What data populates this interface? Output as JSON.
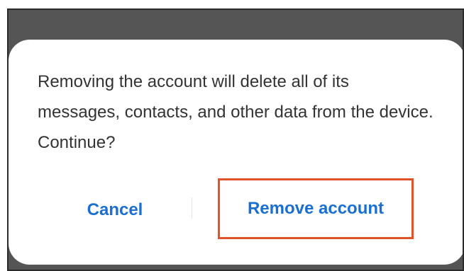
{
  "dialog": {
    "message": "Removing the account will delete all of its messages, contacts, and other data from the device. Continue?",
    "cancel_label": "Cancel",
    "confirm_label": "Remove account"
  },
  "colors": {
    "button_text": "#1a6fd1",
    "highlight_border": "#e0532a",
    "backdrop": "#555555"
  }
}
